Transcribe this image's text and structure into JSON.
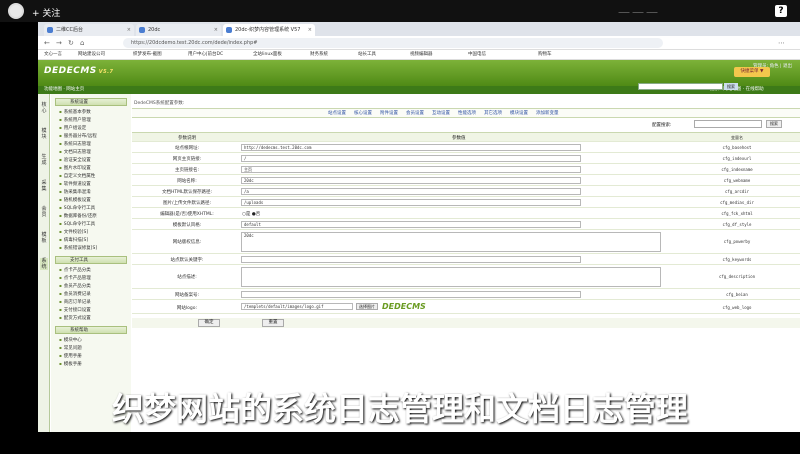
{
  "overlay": {
    "follow": "+ 关注",
    "watermark": "一一一",
    "qr": "?"
  },
  "browser": {
    "tabs": [
      {
        "label": "二维CC后台"
      },
      {
        "label": "20dc"
      },
      {
        "label": "20dc-织梦内容管理系统 V57"
      }
    ],
    "url": "https://20dcdemo.test.20dc.com/dede/index.php#",
    "bookmarks": [
      "文心一言",
      "网站建设公司",
      "织梦发布-截图",
      "用户中心|前台DC",
      "全站linux面板",
      "财务系统",
      "站长工具",
      "视频编辑器",
      "中国电信",
      "购物车"
    ]
  },
  "app": {
    "logo": "DEDECMS",
    "version": "V5.7",
    "toplinks": "管理员: 角色 | 退出",
    "shortcut": "快捷菜单 ▼",
    "strip_left": "功能地图 · 网站主页",
    "strip_right": "搜索 · 网站地图 · 在线帮助",
    "search_btn": "搜索"
  },
  "leftnav": [
    "核心",
    "模块",
    "生成",
    "采集",
    "会员",
    "模板",
    "系统"
  ],
  "menu": {
    "section1": "系统设置",
    "items1": [
      "系统基本参数",
      "系统用户管理",
      "用户组设定",
      "服务器分布/远程",
      "系统日志管理",
      "文档日志管理",
      "验证安全设置",
      "图片水印设置",
      "自定义文档属性",
      "软件频道设置",
      "防采集串混淆",
      "随机模板设置",
      "SQL命令行工具",
      "数据库备份/还原",
      "SQL命令行工具",
      "文件校验[S]",
      "病毒扫描[S]",
      "系统错误修复[S]"
    ],
    "section2": "支付工具",
    "items2": [
      "点卡产品分类",
      "点卡产品管理",
      "会员产品分类",
      "会员消费记录",
      "商店订单记录",
      "支付接口设置",
      "配货方式设置"
    ],
    "section3": "系统帮助",
    "items3": [
      "模块中心",
      "常见问题",
      "使用手册",
      "模板手册"
    ]
  },
  "main": {
    "crumb": "DedeCMS系统配置参数:",
    "tabs": [
      "站点设置",
      "核心设置",
      "附件设置",
      "会员设置",
      "互动设置",
      "性能选项",
      "其它选项",
      "模块设置",
      "添加新变量"
    ],
    "search_label": "配置搜索:",
    "search_btn": "搜索",
    "header": {
      "label": "参数说明",
      "value": "参数值",
      "var": "变量名"
    },
    "rows": [
      {
        "label": "站点根网址:",
        "value": "http://dedecms.test.20dc.com",
        "var": "cfg_basehost"
      },
      {
        "label": "网页主页链接:",
        "value": "/",
        "var": "cfg_indexurl"
      },
      {
        "label": "主页链接名:",
        "value": "主页",
        "var": "cfg_indexname"
      },
      {
        "label": "网站名称:",
        "value": "20dc",
        "var": "cfg_webname"
      },
      {
        "label": "文档HTML默认保存路径:",
        "value": "/a",
        "var": "cfg_arcdir"
      },
      {
        "label": "图片/上传文件默认路径:",
        "value": "/uploads",
        "var": "cfg_medias_dir"
      },
      {
        "label": "编辑器(是/否)使用XHTML:",
        "value": "○是 ●否",
        "var": "cfg_fck_xhtml"
      },
      {
        "label": "模板默认风格:",
        "value": "default",
        "var": "cfg_df_style"
      },
      {
        "label": "网站版权信息:",
        "value": "20dc",
        "var": "cfg_powerby"
      },
      {
        "label": "站点默认关键字:",
        "value": "",
        "var": "cfg_keywords"
      },
      {
        "label": "站点描述:",
        "value": "",
        "var": "cfg_description"
      },
      {
        "label": "网站备案号:",
        "value": "",
        "var": "cfg_beian"
      },
      {
        "label": "网站logo:",
        "value": "/templets/default/images/logo.gif",
        "var": "cfg_web_logo"
      }
    ],
    "logo_btn": "选择图片",
    "logo_img": "DEDECMS",
    "save": "确定",
    "reset": "重置"
  },
  "subtitle": "织梦网站的系统日志管理和文档日志管理"
}
